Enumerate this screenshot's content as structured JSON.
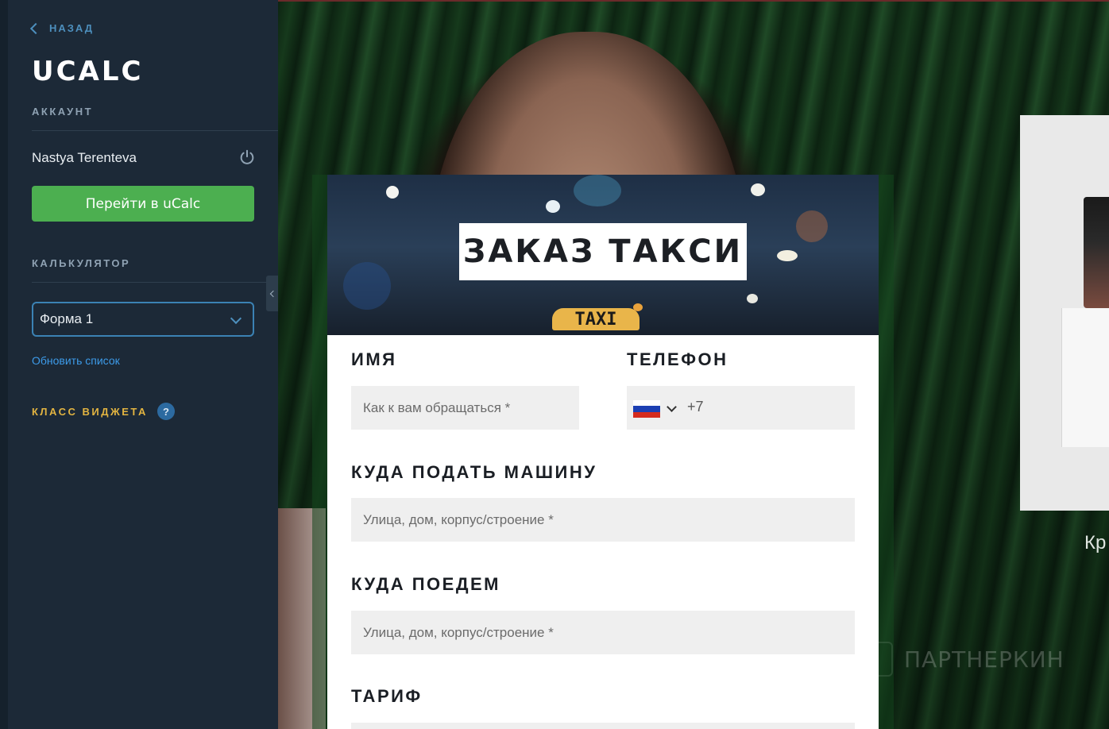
{
  "sidebar": {
    "back_label": "НАЗАД",
    "logo": "UCALC",
    "account_heading": "АККАУНТ",
    "user_name": "Nastya Terenteva",
    "go_button_label": "Перейти в uCalc",
    "calculator_heading": "КАЛЬКУЛЯТОР",
    "selected_form": "Форма 1",
    "refresh_link": "Обновить список",
    "widget_class_label": "КЛАСС ВИДЖЕТА",
    "help_glyph": "?"
  },
  "form": {
    "hero_title": "ЗАКАЗ ТАКСИ",
    "taxi_sign": "TAXI",
    "name_label": "ИМЯ",
    "name_placeholder": "Как к вам обращаться *",
    "phone_label": "ТЕЛЕФОН",
    "phone_prefix": "+7",
    "pickup_label": "КУДА ПОДАТЬ МАШИНУ",
    "pickup_placeholder": "Улица, дом, корпус/строение *",
    "destination_label": "КУДА ПОЕДЕМ",
    "destination_placeholder": "Улица, дом, корпус/строение *",
    "tariff_label": "ТАРИФ"
  },
  "background": {
    "product_caption": "Кр",
    "watermark": "ПАРТНЕРКИН"
  },
  "colors": {
    "sidebar_bg": "#1c2937",
    "accent_green": "#4caf50",
    "accent_blue": "#3b82b4",
    "link_blue": "#3d9be9",
    "widget_class_gold": "#e2b441"
  },
  "icons": [
    "chevron-left-icon",
    "power-icon",
    "chevron-down-icon",
    "help-icon",
    "russia-flag-icon",
    "collapse-chevron-icon"
  ]
}
